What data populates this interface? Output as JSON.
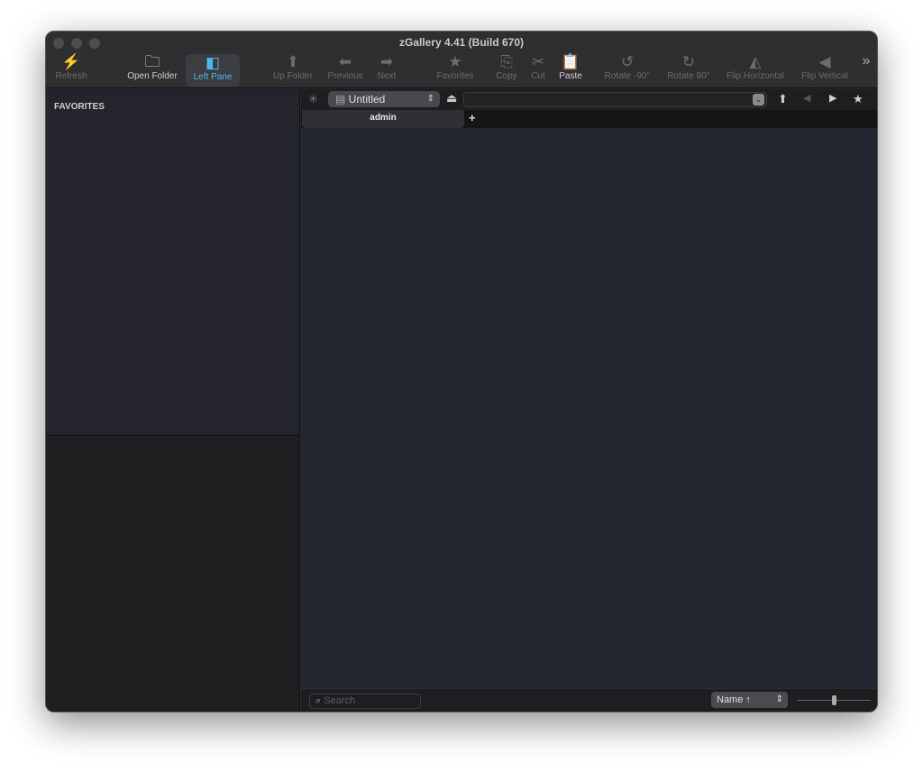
{
  "window": {
    "title": "zGallery 4.41 (Build 670)"
  },
  "toolbar": [
    {
      "label": "Refresh",
      "icon": "refresh-icon",
      "glyph": "⚡",
      "state": "disabled"
    },
    {
      "label": "Open Folder",
      "icon": "folder-icon",
      "glyph": "🗀",
      "state": "enabled"
    },
    {
      "label": "Left Pane",
      "icon": "left-pane-icon",
      "glyph": "◧",
      "state": "selected"
    },
    {
      "label": "Up Folder",
      "icon": "arrow-up-icon",
      "glyph": "⬆",
      "state": "disabled"
    },
    {
      "label": "Previous",
      "icon": "arrow-left-icon",
      "glyph": "⬅",
      "state": "disabled"
    },
    {
      "label": "Next",
      "icon": "arrow-right-icon",
      "glyph": "➡",
      "state": "disabled"
    },
    {
      "label": "Favorites",
      "icon": "star-icon",
      "glyph": "★",
      "state": "disabled"
    },
    {
      "label": "Copy",
      "icon": "copy-icon",
      "glyph": "⎘",
      "state": "disabled"
    },
    {
      "label": "Cut",
      "icon": "scissors-icon",
      "glyph": "✂",
      "state": "disabled"
    },
    {
      "label": "Paste",
      "icon": "paste-icon",
      "glyph": "📋",
      "state": "enabled"
    },
    {
      "label": "Rotate -90°",
      "icon": "rotate-ccw-icon",
      "glyph": "↺",
      "state": "disabled"
    },
    {
      "label": "Rotate 90°",
      "icon": "rotate-cw-icon",
      "glyph": "↻",
      "state": "disabled"
    },
    {
      "label": "Flip Horizontal",
      "icon": "flip-horizontal-icon",
      "glyph": "◭",
      "state": "disabled"
    },
    {
      "label": "Flip Vertical",
      "icon": "flip-vertical-icon",
      "glyph": "◀",
      "state": "disabled"
    }
  ],
  "overflow_glyph": "»",
  "sidebar": {
    "favorites_header": "FAVORITES"
  },
  "pathbar": {
    "volume": "Untitled",
    "path_value": ""
  },
  "tabs": [
    {
      "label": "admin"
    }
  ],
  "bottom": {
    "search_placeholder": "Search",
    "sort": "Name ↑",
    "zoom_level": 0.5
  },
  "colors": {
    "accent": "#4fb6ee"
  }
}
